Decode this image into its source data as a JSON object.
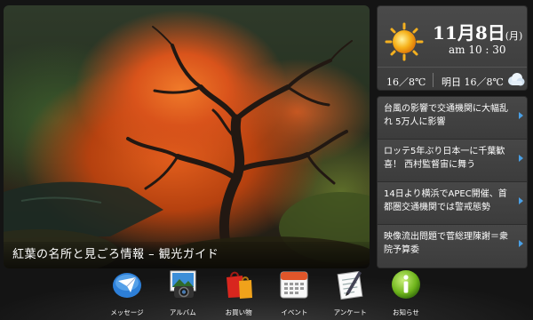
{
  "photo": {
    "caption": "紅葉の名所と見ごろ情報 – 観光ガイド"
  },
  "weather": {
    "date": "11月8日",
    "weekday": "(月)",
    "time": "am 10 : 30",
    "today_temp": "16／8℃",
    "tomorrow_label": "明日",
    "tomorrow_temp": "16／8℃",
    "today_icon": "sun-icon",
    "tomorrow_icon": "cloud-icon"
  },
  "news": {
    "items": [
      {
        "text": "台風の影響で交通機関に大幅乱れ 5万人に影響"
      },
      {
        "text": "ロッテ5年ぶり日本一に千葉歓喜！ 西村監督宙に舞う"
      },
      {
        "text": "14日より横浜でAPEC開催、首都圏交通機関では警戒態勢"
      },
      {
        "text": "映像流出問題で菅総理陳謝＝衆院予算委"
      }
    ]
  },
  "dock": {
    "items": [
      {
        "label": "メッセージ",
        "icon": "message-icon"
      },
      {
        "label": "アルバム",
        "icon": "album-icon"
      },
      {
        "label": "お買い物",
        "icon": "shopping-icon"
      },
      {
        "label": "イベント",
        "icon": "calendar-icon"
      },
      {
        "label": "アンケート",
        "icon": "survey-icon"
      },
      {
        "label": "お知らせ",
        "icon": "info-icon"
      }
    ]
  },
  "colors": {
    "accent": "#4aa0e6",
    "panel": "#3e3e3e",
    "background": "#141414"
  }
}
